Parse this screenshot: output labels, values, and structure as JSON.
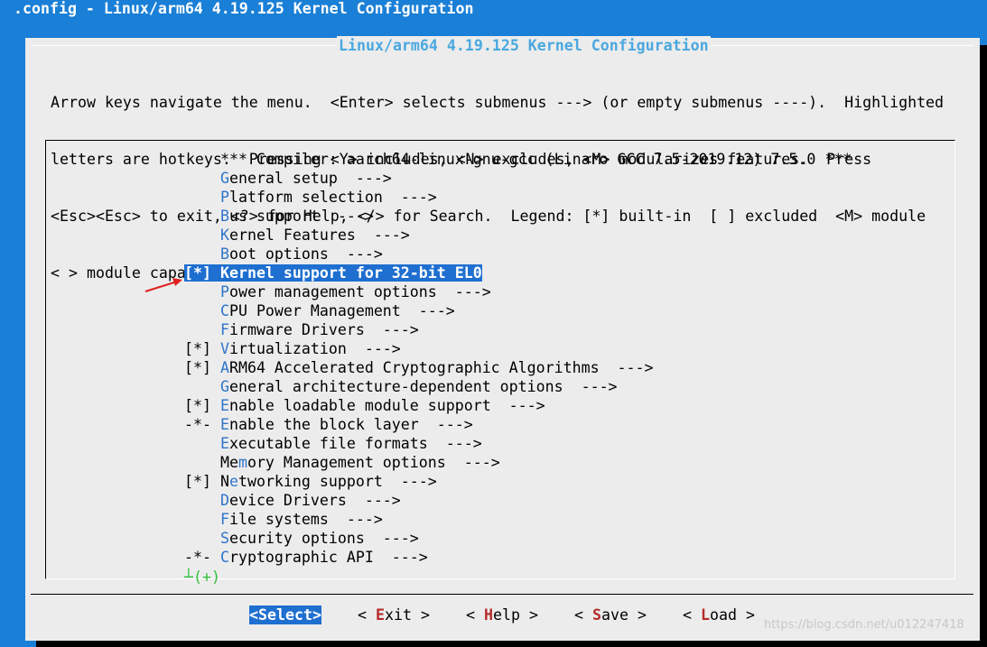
{
  "window": {
    "title": ".config - Linux/arm64 4.19.125 Kernel Configuration"
  },
  "dialog": {
    "title": "Linux/arm64 4.19.125 Kernel Configuration",
    "help_lines": [
      "Arrow keys navigate the menu.  <Enter> selects submenus ---> (or empty submenus ----).  Highlighted",
      "letters are hotkeys.  Pressing <Y> includes, <N> excludes, <M> modularizes features.  Press",
      "<Esc><Esc> to exit, <?> for Help, </> for Search.  Legend: [*] built-in  [ ] excluded  <M> module",
      "< > module capable"
    ]
  },
  "menu": {
    "items": [
      {
        "prefix": "    ",
        "hotkey": "",
        "rest": "*** Compiler: aarch64-linux-gnu-gcc (Linaro GCC 7.5-2019.12) 7.5.0 ***"
      },
      {
        "prefix": "    ",
        "hotkey": "G",
        "rest": "eneral setup  --->"
      },
      {
        "prefix": "    ",
        "hotkey": "P",
        "rest": "latform selection  --->"
      },
      {
        "prefix": "    ",
        "hotkey": "B",
        "rest": "us support  --->"
      },
      {
        "prefix": "    ",
        "hotkey": "K",
        "rest": "ernel Features  --->"
      },
      {
        "prefix": "    ",
        "hotkey": "B",
        "rest": "oot options  --->"
      },
      {
        "prefix": "[*] ",
        "hotkey": "K",
        "rest": "ernel support for 32-bit EL0",
        "selected": true
      },
      {
        "prefix": "    ",
        "hotkey": "P",
        "rest": "ower management options  --->"
      },
      {
        "prefix": "    ",
        "hotkey": "C",
        "rest": "PU Power Management  --->"
      },
      {
        "prefix": "    ",
        "hotkey": "F",
        "rest": "irmware Drivers  --->"
      },
      {
        "prefix": "[*] ",
        "hotkey": "V",
        "rest": "irtualization  --->"
      },
      {
        "prefix": "[*] ",
        "hotkey": "A",
        "rest": "RM64 Accelerated Cryptographic Algorithms  --->"
      },
      {
        "prefix": "    ",
        "hotkey": "G",
        "rest": "eneral architecture-dependent options  --->"
      },
      {
        "prefix": "[*] ",
        "hotkey": "E",
        "rest": "nable loadable module support  --->"
      },
      {
        "prefix": "-*- ",
        "hotkey": "E",
        "rest": "nable the block layer  --->"
      },
      {
        "prefix": "    ",
        "hotkey": "E",
        "rest": "xecutable file formats  --->"
      },
      {
        "prefix": "    ",
        "hotkey": "",
        "rest": "Memory Management options  --->",
        "hk_index": 2
      },
      {
        "prefix": "[*] ",
        "hotkey": "",
        "rest": "Networking support  --->",
        "hk_index": 1
      },
      {
        "prefix": "    ",
        "hotkey": "D",
        "rest": "evice Drivers  --->"
      },
      {
        "prefix": "    ",
        "hotkey": "F",
        "rest": "ile systems  --->"
      },
      {
        "prefix": "    ",
        "hotkey": "S",
        "rest": "ecurity options  --->"
      },
      {
        "prefix": "-*- ",
        "hotkey": "C",
        "rest": "ryptographic API  --->"
      }
    ],
    "more_indicator": "┴(+)"
  },
  "buttons": [
    {
      "pre": "<",
      "hotkey": "S",
      "rest": "elect",
      "post": ">",
      "selected": true
    },
    {
      "pre": "< ",
      "hotkey": "E",
      "rest": "xit",
      "post": " >"
    },
    {
      "pre": "< ",
      "hotkey": "H",
      "rest": "elp",
      "post": " >"
    },
    {
      "pre": "< ",
      "hotkey": "S",
      "rest": "ave",
      "post": " >"
    },
    {
      "pre": "< ",
      "hotkey": "L",
      "rest": "oad",
      "post": " >"
    }
  ],
  "watermark": "https://blog.csdn.net/u012247418",
  "colors": {
    "background": "#1a7fd6",
    "dialog": "#ececec",
    "selection": "#1e6fd0",
    "hotkey": "#2f74c9",
    "button_hotkey": "#b52a2a",
    "title_text": "#4aa8e0",
    "annotation_arrow": "#e02020"
  }
}
